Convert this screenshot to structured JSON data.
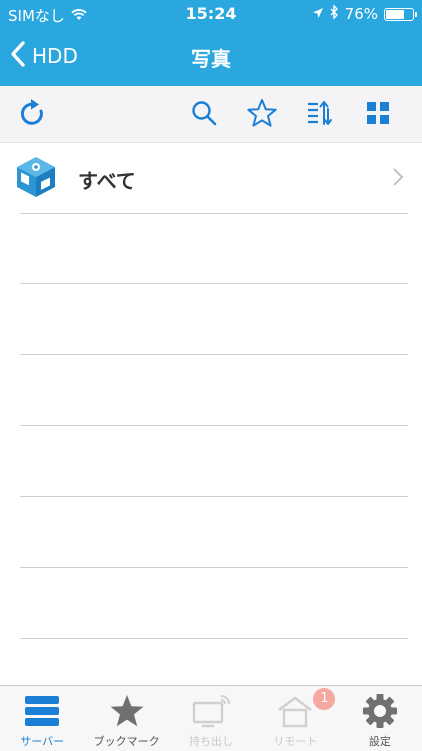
{
  "status": {
    "carrier": "SIMなし",
    "time": "15:24",
    "battery_text": "76%",
    "battery_level": 0.76
  },
  "nav": {
    "back_label": "HDD",
    "title": "写真"
  },
  "toolbar": {
    "icons": [
      "refresh-icon",
      "search-icon",
      "star-icon",
      "sort-icon",
      "grid-icon"
    ]
  },
  "list": {
    "items": [
      {
        "label": "すべて",
        "icon": "photo-folder-icon"
      }
    ]
  },
  "tabs": [
    {
      "label": "サーバー",
      "icon": "server-icon",
      "state": "active"
    },
    {
      "label": "ブックマーク",
      "icon": "star-icon",
      "state": "normal"
    },
    {
      "label": "持ち出し",
      "icon": "cast-icon",
      "state": "disabled"
    },
    {
      "label": "リモート",
      "icon": "home-remote-icon",
      "state": "disabled",
      "badge": "1"
    },
    {
      "label": "設定",
      "icon": "gear-icon",
      "state": "normal"
    }
  ],
  "colors": {
    "header": "#2aa7de",
    "accent": "#1c7fd6",
    "badge": "#f5a7a0"
  }
}
